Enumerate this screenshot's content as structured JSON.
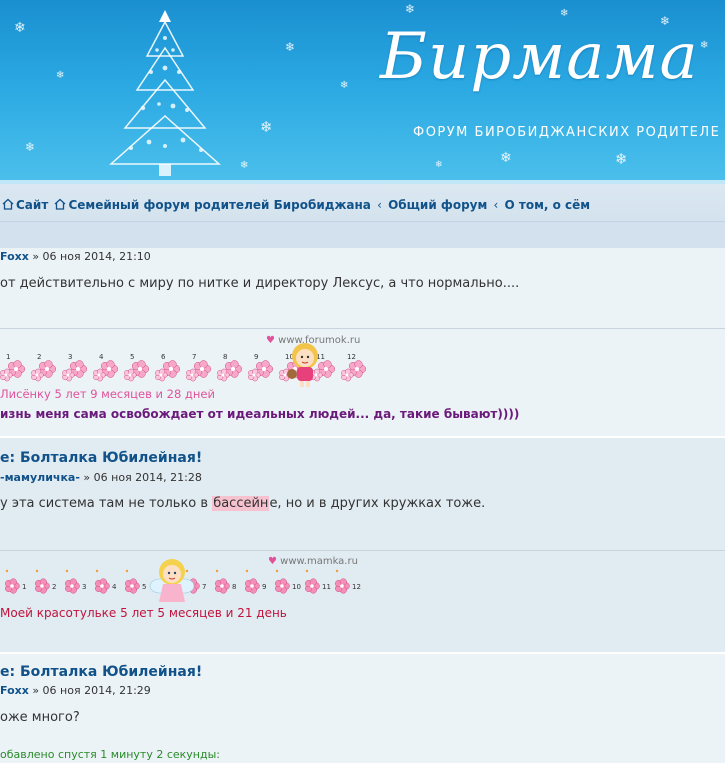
{
  "header": {
    "logo_text": "Бирмама",
    "subtitle": "ФОРУМ БИРОБИДЖАНСКИХ РОДИТЕЛЕ"
  },
  "breadcrumb": {
    "items": [
      {
        "label": "Сайт",
        "icon": "home-icon"
      },
      {
        "label": "Семейный форум родителей Биробиджана",
        "icon": "home-icon"
      },
      {
        "label": "Общий форум",
        "icon": ""
      },
      {
        "label": "О том, о сём",
        "icon": ""
      }
    ],
    "separator": "‹"
  },
  "posts": [
    {
      "author_prefix": "",
      "author": "Foxx",
      "date": "» 06 ноя 2014, 21:10",
      "content": "от действительно с миру по нитке и директору Лексус, а что нормально....",
      "sig_credit": "www.forumok.ru",
      "ticker_caption": "Лисёнку 5 лет 9 месяцев и 28 дней",
      "sig_quote": "изнь меня сама освобождает от идеальных людей... да, такие бывают))))"
    },
    {
      "title": "е: Болталка Юбилейная!",
      "author_prefix": "",
      "author": "-мамуличка-",
      "date": "» 06 ноя 2014, 21:28",
      "content_before": "у эта система там не только в ",
      "content_highlight": "бассейн",
      "content_after": "е, но и в других кружках тоже.",
      "sig_credit": "www.mamka.ru",
      "ticker_caption": "Моей красотульке 5 лет 5 месяцев и 21 день"
    },
    {
      "title": "е: Болталка Юбилейная!",
      "author_prefix": "",
      "author": "Foxx",
      "date": "» 06 ноя 2014, 21:29",
      "content": "оже много?",
      "added_note": "обавлено спустя 1 минуту 2 секунды:"
    }
  ],
  "ticker_numbers": [
    "1",
    "2",
    "3",
    "4",
    "5",
    "6",
    "7",
    "8",
    "9",
    "10",
    "11",
    "12"
  ],
  "colors": {
    "banner_top": "#1a8fd0",
    "link": "#105289",
    "post_bg1": "#e1ebf2",
    "post_bg2": "#ecf3f7",
    "highlight": "#f6c2cf",
    "ticker_pink": "#e0529a",
    "ticker_red": "#c0143c",
    "quote_purple": "#6a1a7a",
    "added_green": "#2a8a2a"
  }
}
